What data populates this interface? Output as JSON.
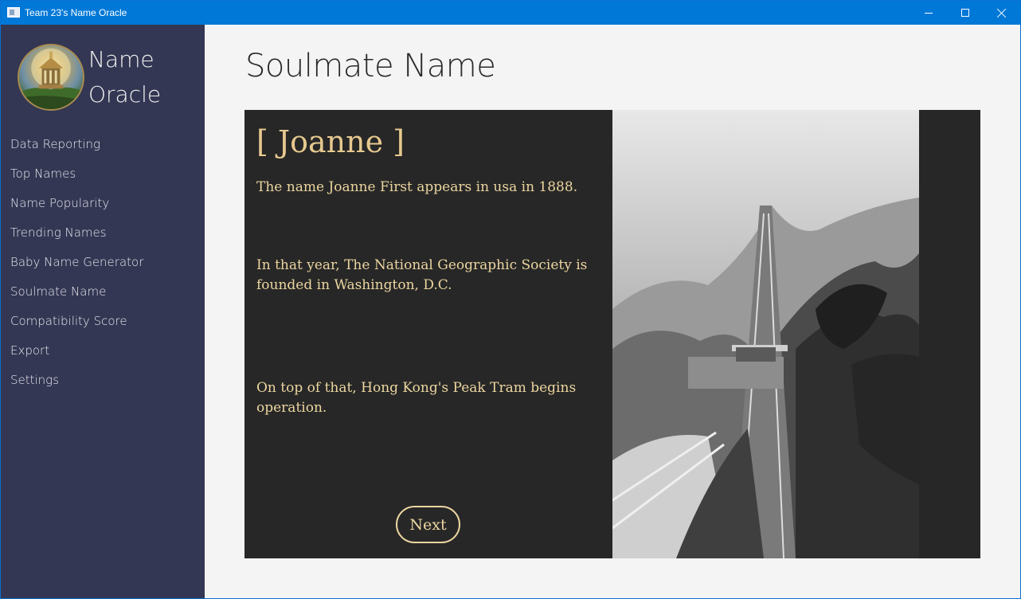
{
  "window": {
    "title": "Team 23's Name Oracle"
  },
  "sidebar": {
    "brand_line1": "Name",
    "brand_line2": "Oracle",
    "items": [
      {
        "label": "Data Reporting"
      },
      {
        "label": "Top Names"
      },
      {
        "label": "Name Popularity"
      },
      {
        "label": "Trending Names"
      },
      {
        "label": "Baby Name Generator"
      },
      {
        "label": "Soulmate Name"
      },
      {
        "label": "Compatibility Score"
      },
      {
        "label": "Export"
      },
      {
        "label": "Settings"
      }
    ]
  },
  "main": {
    "page_title": "Soulmate Name",
    "card": {
      "name_heading": "[ Joanne ]",
      "facts": [
        "The name Joanne First appears in usa in 1888.",
        "In that year, The National Geographic Society is founded in Washington, D.C.",
        "On top of that, Hong Kong's Peak Tram begins operation."
      ],
      "next_label": "Next"
    }
  },
  "colors": {
    "titlebar": "#0078d7",
    "sidebar": "#333753",
    "card": "#272727",
    "accent_text": "#ecd6a0"
  },
  "icons": {
    "app": "app-window-icon",
    "minimize": "minimize-icon",
    "maximize": "maximize-icon",
    "close": "close-icon"
  }
}
